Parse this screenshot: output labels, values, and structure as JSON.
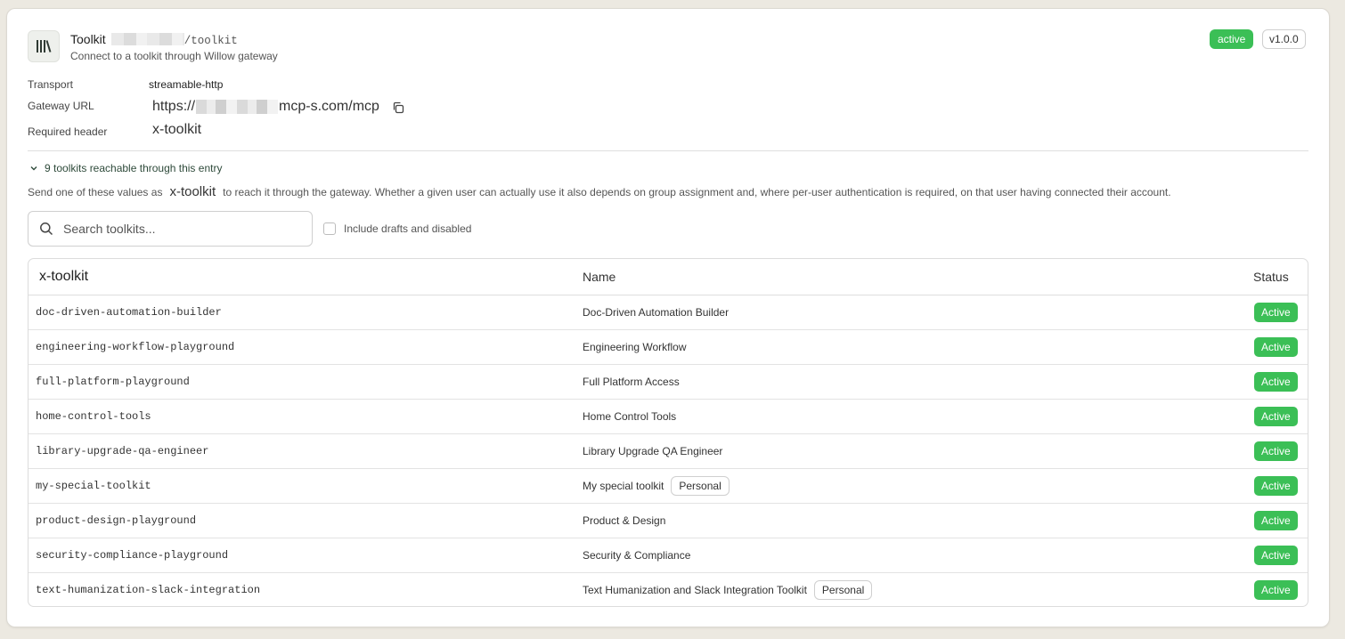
{
  "header": {
    "icon": "library-icon",
    "title": "Toolkit",
    "path": "/toolkit",
    "subtitle": "Connect to a toolkit through Willow gateway",
    "status_badge": "active",
    "version": "v1.0.0"
  },
  "meta": {
    "transport_label": "Transport",
    "transport_value": "streamable-http",
    "gateway_label": "Gateway URL",
    "gateway_prefix": "https://",
    "gateway_suffix": "mcp-s.com/mcp",
    "header_label": "Required header",
    "header_value": "x-toolkit"
  },
  "reach": {
    "toggle_label": "9 toolkits reachable through this entry",
    "desc_before": "Send one of these values as",
    "desc_code": "x-toolkit",
    "desc_after": "to reach it through the gateway. Whether a given user can actually use it also depends on group assignment and, where per-user authentication is required, on that user having connected their account."
  },
  "search": {
    "placeholder": "Search toolkits...",
    "value": "",
    "include_label": "Include drafts and disabled",
    "include_checked": false
  },
  "table": {
    "columns": {
      "key": "x-toolkit",
      "name": "Name",
      "status": "Status"
    },
    "rows": [
      {
        "key": "doc-driven-automation-builder",
        "name": "Doc-Driven Automation Builder",
        "tag": "",
        "status": "Active"
      },
      {
        "key": "engineering-workflow-playground",
        "name": "Engineering Workflow",
        "tag": "",
        "status": "Active"
      },
      {
        "key": "full-platform-playground",
        "name": "Full Platform Access",
        "tag": "",
        "status": "Active"
      },
      {
        "key": "home-control-tools",
        "name": "Home Control Tools",
        "tag": "",
        "status": "Active"
      },
      {
        "key": "library-upgrade-qa-engineer",
        "name": "Library Upgrade QA Engineer",
        "tag": "",
        "status": "Active"
      },
      {
        "key": "my-special-toolkit",
        "name": "My special toolkit",
        "tag": "Personal",
        "status": "Active"
      },
      {
        "key": "product-design-playground",
        "name": "Product & Design",
        "tag": "",
        "status": "Active"
      },
      {
        "key": "security-compliance-playground",
        "name": "Security & Compliance",
        "tag": "",
        "status": "Active"
      },
      {
        "key": "text-humanization-slack-integration",
        "name": "Text Humanization and Slack Integration Toolkit",
        "tag": "Personal",
        "status": "Active"
      }
    ]
  },
  "colors": {
    "accent_green": "#3bbf56",
    "page_bg": "#ece9e1"
  }
}
